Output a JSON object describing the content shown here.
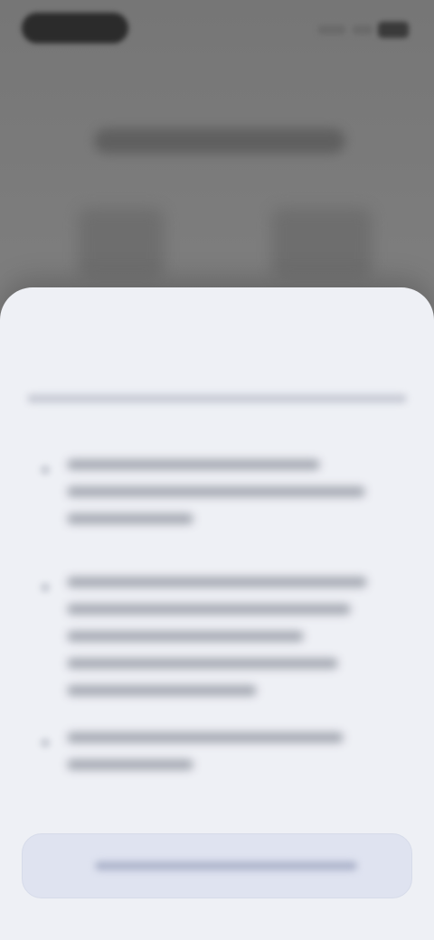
{
  "status_bar": {
    "time": "",
    "icons": [
      "signal-icon",
      "wifi-icon",
      "battery-icon"
    ]
  },
  "sheet": {
    "title": "",
    "subtitle": "",
    "cta_label": ""
  },
  "colors": {
    "backdrop": "#7b7b7b",
    "sheet_background": "#eef0f5",
    "title_text": "#2b2e37",
    "body_text_blur": "#9ea2ac",
    "cta_background": "#dfe3f0"
  }
}
